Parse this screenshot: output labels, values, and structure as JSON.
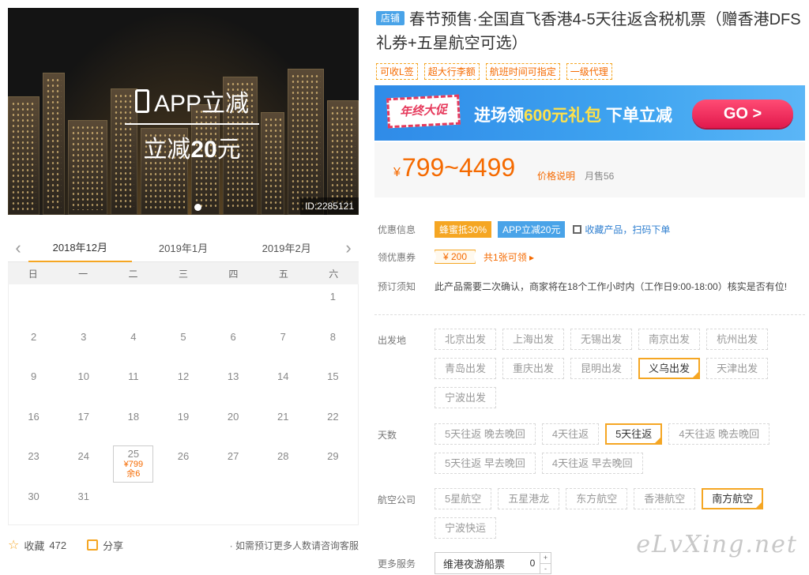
{
  "hero": {
    "promo_line1": "APP立减",
    "promo_line2_prefix": "立减",
    "promo_line2_amount": "20",
    "promo_line2_suffix": "元",
    "id_tag": "ID:2285121"
  },
  "calendar": {
    "months": [
      "2018年12月",
      "2019年1月",
      "2019年2月"
    ],
    "active_month_index": 0,
    "weekdays": [
      "日",
      "一",
      "二",
      "三",
      "四",
      "五",
      "六"
    ],
    "days": [
      "",
      "",
      "",
      "",
      "",
      "",
      "1",
      "2",
      "3",
      "4",
      "5",
      "6",
      "7",
      "8",
      "9",
      "10",
      "11",
      "12",
      "13",
      "14",
      "15",
      "16",
      "17",
      "18",
      "19",
      "20",
      "21",
      "22",
      "23",
      "24",
      "25",
      "26",
      "27",
      "28",
      "29",
      "30",
      "31",
      "",
      "",
      "",
      "",
      ""
    ],
    "selected_day": "25",
    "selected_price": "¥799",
    "selected_stock": "余6"
  },
  "footer": {
    "fav_label": "收藏",
    "fav_count": "472",
    "share_label": "分享",
    "consult": "· 如需预订更多人数请咨询客服"
  },
  "product": {
    "shop_badge": "店铺",
    "title": "春节预售·全国直飞香港4-5天往返含税机票（赠香港DFS礼券+五星航空可选）",
    "tags": [
      "可收L签",
      "超大行李额",
      "航班时间可指定",
      "一级代理"
    ]
  },
  "banner": {
    "badge": "年终大促",
    "msg_prefix": "进场领",
    "msg_amount": "600元礼包",
    "msg_suffix": "下单立减",
    "go": "GO >"
  },
  "price": {
    "currency": "¥",
    "range": "799~4499",
    "explain": "价格说明",
    "sold": "月售56"
  },
  "offers": {
    "label": "优惠信息",
    "honey": "蜂蜜抵30%",
    "app": "APP立减20元",
    "qr": "收藏产品，扫码下单"
  },
  "coupon": {
    "label": "领优惠券",
    "value": "¥ 200",
    "more": "共1张可领 ▸"
  },
  "notice": {
    "label": "预订须知",
    "text": "此产品需要二次确认，商家将在18个工作小时内（工作日9:00-18:00）核实是否有位!"
  },
  "departure": {
    "label": "出发地",
    "options": [
      "北京出发",
      "上海出发",
      "无锡出发",
      "南京出发",
      "杭州出发",
      "青岛出发",
      "重庆出发",
      "昆明出发",
      "义乌出发",
      "天津出发",
      "宁波出发"
    ],
    "selected": "义乌出发"
  },
  "days_opt": {
    "label": "天数",
    "options": [
      "5天往返 晚去晚回",
      "4天往返",
      "5天往返",
      "4天往返 晚去晚回",
      "5天往返 早去晚回",
      "4天往返 早去晚回"
    ],
    "selected": "5天往返"
  },
  "airline": {
    "label": "航空公司",
    "options": [
      "5星航空",
      "五星港龙",
      "东方航空",
      "香港航空",
      "南方航空",
      "宁波快运"
    ],
    "selected": "南方航空"
  },
  "service": {
    "label": "更多服务",
    "name": "维港夜游船票",
    "qty": "0",
    "plus": "+",
    "minus": "-"
  },
  "watermark": "eLvXing.net"
}
